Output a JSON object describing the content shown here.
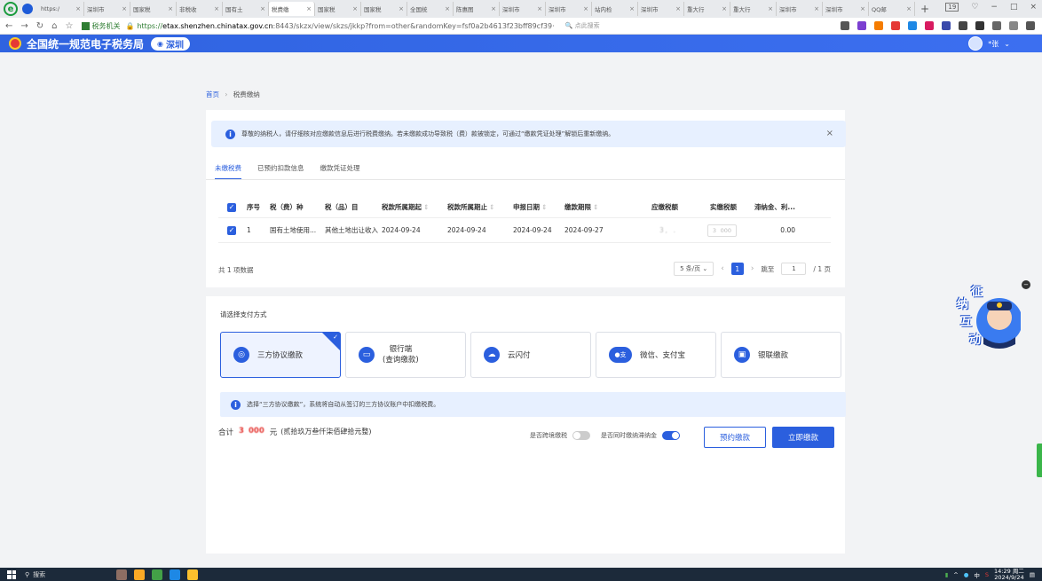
{
  "browser": {
    "tabs": [
      {
        "label": "https:/",
        "active": false
      },
      {
        "label": "深圳市",
        "active": false
      },
      {
        "label": "国家税",
        "active": false
      },
      {
        "label": "非税收",
        "active": false
      },
      {
        "label": "国有土",
        "active": false
      },
      {
        "label": "税费缴",
        "active": true
      },
      {
        "label": "国家税",
        "active": false
      },
      {
        "label": "国家税",
        "active": false
      },
      {
        "label": "全国统",
        "active": false
      },
      {
        "label": "陈惠图",
        "active": false
      },
      {
        "label": "深圳市",
        "active": false
      },
      {
        "label": "深圳市",
        "active": false
      },
      {
        "label": "站内检",
        "active": false
      },
      {
        "label": "深圳市",
        "active": false
      },
      {
        "label": "重大行",
        "active": false
      },
      {
        "label": "重大行",
        "active": false
      },
      {
        "label": "深圳市",
        "active": false
      },
      {
        "label": "深圳市",
        "active": false
      },
      {
        "label": "QQ邮",
        "active": false
      }
    ],
    "tab_badge": "19",
    "url_site": "税务机关",
    "url_proto": "https://",
    "url_host": "etax.shenzhen.chinatax.gov.cn",
    "url_path": ":8443/skzx/view/skzs/jkkp?from=other&randomKey=fsf0a2b4613f23bff89cf39·",
    "search_placeholder": "点此搜索"
  },
  "header": {
    "title": "全国统一规范电子税务局",
    "region": "深圳",
    "user_name": "*张"
  },
  "breadcrumb": {
    "home": "首页",
    "current": "税费缴纳"
  },
  "notice": {
    "text": "尊敬的纳税人，请仔细核对应缴款信息后进行税费缴纳。若未缴款成功导致税（费）款被锁定，可通过“缴款凭证处理”解锁后重新缴纳。"
  },
  "tabs": [
    "未缴税费",
    "已预约扣款信息",
    "缴款凭证处理"
  ],
  "table": {
    "headers": [
      "序号",
      "税（费）种",
      "税（品）目",
      "税款所属期起",
      "税款所属期止",
      "申报日期",
      "缴款期限",
      "应缴税额",
      "实缴税额",
      "滞纳金、利..."
    ],
    "rows": [
      {
        "no": "1",
        "type": "国有土地使用...",
        "item": "其他土地出让收入",
        "start": "2024-09-24",
        "end": "2024-09-24",
        "declare": "2024-09-24",
        "due": "2024-09-27",
        "amount": "3 ,     .  ",
        "paid": "3       000",
        "late": "0.00"
      }
    ],
    "total_text": "共 1 项数据",
    "page_size": "5 条/页",
    "page": "1",
    "goto_label": "跳至",
    "goto_value": "1",
    "page_total": "/ 1 页"
  },
  "payment": {
    "title": "请选择支付方式",
    "methods": [
      {
        "label": "三方协议缴款",
        "selected": true
      },
      {
        "label": "银行端\n(查询缴款)",
        "selected": false
      },
      {
        "label": "云闪付",
        "selected": false
      },
      {
        "label": "微信、支付宝",
        "selected": false
      },
      {
        "label": "银联缴款",
        "selected": false
      }
    ],
    "note": "选择“三方协议缴款”，系统将自动从签订的三方协议账户中扣缴税费。",
    "total_label": "合计",
    "total_amount": "3      000",
    "total_unit": "元",
    "total_words": "(贰拾玖万叁仟柒佰肆拾元整)",
    "cross_border_label": "是否跨境缴税",
    "late_fee_label": "是否同时缴纳滞纳金",
    "reserve_button": "预约缴款",
    "pay_button": "立即缴款"
  },
  "widget": {
    "chars": [
      "征",
      "纳",
      "互",
      "动"
    ]
  },
  "taskbar": {
    "search": "搜索",
    "time": "14:29 周二",
    "date": "2024/9/24"
  },
  "colors": {
    "primary": "#2b5fde",
    "danger": "#e53935"
  }
}
